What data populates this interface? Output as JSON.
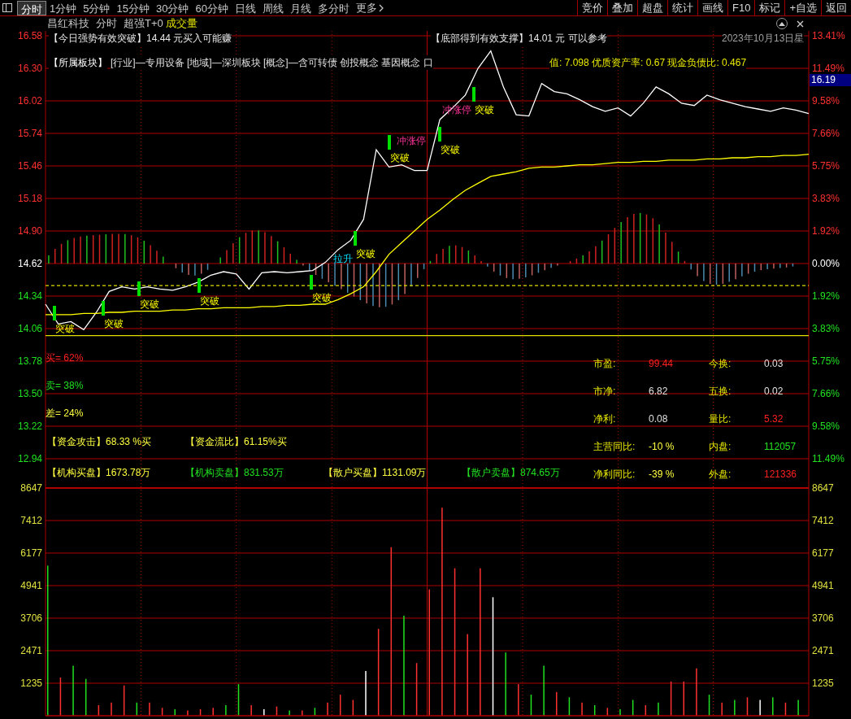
{
  "toolbar": {
    "tabs": [
      {
        "label": "分时",
        "selected": true
      },
      {
        "label": "1分钟",
        "selected": false
      },
      {
        "label": "5分钟",
        "selected": false
      },
      {
        "label": "15分钟",
        "selected": false
      },
      {
        "label": "30分钟",
        "selected": false
      },
      {
        "label": "60分钟",
        "selected": false
      },
      {
        "label": "日线",
        "selected": false
      },
      {
        "label": "周线",
        "selected": false
      },
      {
        "label": "月线",
        "selected": false
      },
      {
        "label": "多分时",
        "selected": false
      }
    ],
    "more": "更多",
    "buttons": [
      "竞价",
      "叠加",
      "超盘",
      "统计",
      "画线",
      "F10",
      "标记",
      "+自选",
      "返回"
    ]
  },
  "title_row": {
    "items": [
      "昌红科技",
      "分时",
      "超强T+0"
    ],
    "indicator": "成交量"
  },
  "info": {
    "signal_left": "【今日强势有效突破】14.44 元买入可能赚",
    "signal_right": "【底部得到有效支撑】14.01 元 可以参考",
    "date": "2023年10月13日星",
    "sector_label": "【所属板块】",
    "sector": "[行业]—专用设备 [地域]—深圳板块 [概念]—含可转债 创投概念 基因概念 口",
    "finance": "值: 7.098 优质资产率: 0.67 现金负债比: 0.467",
    "price_tag": "16.19"
  },
  "price_chart": {
    "chart_data": {
      "type": "line",
      "ylim": [
        12.94,
        16.58
      ],
      "grid": true,
      "yticks": [
        {
          "value": 16.58,
          "label": "16.58"
        },
        {
          "value": 16.3,
          "label": "16.30"
        },
        {
          "value": 16.02,
          "label": "16.02"
        },
        {
          "value": 15.74,
          "label": "15.74"
        },
        {
          "value": 15.46,
          "label": "15.46"
        },
        {
          "value": 15.18,
          "label": "15.18"
        },
        {
          "value": 14.9,
          "label": "14.90"
        },
        {
          "value": 14.62,
          "label": "14.62"
        },
        {
          "value": 14.34,
          "label": "14.34"
        },
        {
          "value": 14.06,
          "label": "14.06"
        },
        {
          "value": 13.78,
          "label": "13.78"
        },
        {
          "value": 13.5,
          "label": "13.50"
        },
        {
          "value": 13.22,
          "label": "13.22"
        },
        {
          "value": 12.94,
          "label": "12.94"
        }
      ],
      "categories": [
        null,
        null,
        null,
        null,
        null,
        null,
        null,
        null,
        null,
        null,
        null,
        null,
        null,
        null,
        null,
        null,
        null,
        null,
        null,
        null,
        null,
        null,
        null,
        null,
        null,
        null,
        null,
        null,
        null,
        null,
        null,
        null,
        null,
        null,
        null,
        null,
        null,
        null,
        null,
        null,
        null,
        null,
        null,
        null,
        null,
        null,
        null,
        null,
        null,
        null,
        null,
        null,
        null,
        null,
        null,
        null,
        null,
        null,
        null,
        null,
        null
      ],
      "series": [
        {
          "color": "#ffffff",
          "values": [
            14.27,
            14.1,
            14.12,
            14.05,
            14.2,
            14.38,
            14.42,
            14.4,
            14.42,
            14.4,
            14.39,
            14.42,
            14.46,
            14.52,
            14.55,
            14.53,
            14.4,
            14.54,
            14.55,
            14.54,
            14.55,
            14.56,
            14.63,
            14.74,
            14.82,
            15.0,
            15.6,
            15.45,
            15.47,
            15.42,
            15.42,
            15.86,
            15.96,
            16.07,
            16.3,
            16.45,
            16.14,
            15.9,
            15.89,
            16.17,
            16.1,
            16.08,
            16.03,
            15.97,
            15.93,
            15.96,
            15.89,
            16.0,
            16.14,
            16.08,
            16.0,
            15.98,
            16.07,
            16.03,
            16.0,
            15.97,
            15.95,
            15.93,
            15.96,
            15.94,
            15.91
          ]
        },
        {
          "color": "#ffff00",
          "values": [
            14.18,
            14.18,
            14.18,
            14.19,
            14.19,
            14.2,
            14.2,
            14.21,
            14.21,
            14.21,
            14.22,
            14.22,
            14.23,
            14.23,
            14.24,
            14.24,
            14.24,
            14.25,
            14.25,
            14.26,
            14.26,
            14.27,
            14.27,
            14.31,
            14.36,
            14.42,
            14.55,
            14.7,
            14.8,
            14.9,
            15.0,
            15.08,
            15.17,
            15.25,
            15.31,
            15.37,
            15.39,
            15.41,
            15.44,
            15.45,
            15.45,
            15.46,
            15.47,
            15.47,
            15.48,
            15.49,
            15.49,
            15.5,
            15.5,
            15.51,
            15.51,
            15.51,
            15.52,
            15.52,
            15.53,
            15.53,
            15.54,
            15.54,
            15.55,
            15.55,
            15.56
          ]
        },
        {
          "color": "#e0e000",
          "line_style": "dashed",
          "values": [
            14.43,
            14.43,
            14.43,
            14.43,
            14.43,
            14.43,
            14.43,
            14.43,
            14.43,
            14.43,
            14.43,
            14.43,
            14.43,
            14.43,
            14.43,
            14.43,
            14.43,
            14.43,
            14.43,
            14.43,
            14.43,
            14.43,
            14.43,
            14.43,
            14.43,
            14.43,
            14.43,
            14.43,
            14.43,
            14.43,
            14.43,
            14.43,
            14.43,
            14.43,
            14.43,
            14.43,
            14.43,
            14.43,
            14.43,
            14.43,
            14.43,
            14.43,
            14.43,
            14.43,
            14.43,
            14.43,
            14.43,
            14.43,
            14.43,
            14.43,
            14.43,
            14.43,
            14.43,
            14.43,
            14.43,
            14.43,
            14.43,
            14.43,
            14.43,
            14.43,
            14.43
          ]
        },
        {
          "color": "#e0e000",
          "values": [
            14.0,
            14.0,
            14.0,
            14.0,
            14.0,
            14.0,
            14.0,
            14.0,
            14.0,
            14.0,
            14.0,
            14.0,
            14.0,
            14.0,
            14.0,
            14.0,
            14.0,
            14.0,
            14.0,
            14.0,
            14.0,
            14.0,
            14.0,
            14.0,
            14.0,
            14.0,
            14.0,
            14.0,
            14.0,
            14.0,
            14.0,
            14.0,
            14.0,
            14.0,
            14.0,
            14.0,
            14.0,
            14.0,
            14.0,
            14.0,
            14.0,
            14.0,
            14.0,
            14.0,
            14.0,
            14.0,
            14.0,
            14.0,
            14.0,
            14.0,
            14.0,
            14.0,
            14.0,
            14.0,
            14.0,
            14.0,
            14.0,
            14.0,
            14.0,
            14.0,
            14.0
          ]
        }
      ]
    },
    "right_axis": [
      "13.41%",
      "11.49%",
      "9.58%",
      "7.66%",
      "5.75%",
      "3.83%",
      "1.92%",
      "0.00%",
      "1.92%",
      "3.83%",
      "5.75%",
      "7.66%",
      "9.58%",
      "11.49%"
    ],
    "signals": [
      {
        "text": "突破",
        "kind": "breakout"
      },
      {
        "text": "突破",
        "kind": "breakout"
      },
      {
        "text": "突破",
        "kind": "breakout"
      },
      {
        "text": "突破",
        "kind": "breakout"
      },
      {
        "text": "突破",
        "kind": "breakout"
      },
      {
        "text": "拉升",
        "kind": "pull_up"
      },
      {
        "text": "突破",
        "kind": "breakout"
      },
      {
        "text": "突破",
        "kind": "breakout"
      },
      {
        "text": "冲涨停",
        "kind": "limit_up"
      },
      {
        "text": "突破",
        "kind": "breakout"
      },
      {
        "text": "冲涨停",
        "kind": "limit_up"
      },
      {
        "text": "突破",
        "kind": "breakout"
      }
    ]
  },
  "ratios": [
    {
      "text": "买= 62%",
      "color": "#ff2020"
    },
    {
      "text": "卖= 38%",
      "color": "#20e020"
    },
    {
      "text": "差= 24%",
      "color": "#ffff40"
    }
  ],
  "funds": [
    [
      {
        "label": "【资金攻击】",
        "value": "68.33 %买",
        "color": "#ffff40"
      },
      {
        "label": "【资金流比】",
        "value": "61.15%买",
        "color": "#ffff40"
      }
    ],
    [
      {
        "label": "【机构买盘】",
        "value": "1673.78万",
        "color": "#ffff40"
      },
      {
        "label": "【机构卖盘】",
        "value": "831.53万",
        "color": "#20e020"
      },
      {
        "label": "【散户买盘】",
        "value": "1131.09万",
        "color": "#ffff40"
      },
      {
        "label": "【散户卖盘】",
        "value": "874.65万",
        "color": "#20e020"
      }
    ]
  ],
  "stats": [
    [
      {
        "label": "市盈:",
        "value": "99.44",
        "color": "#ff2020"
      },
      {
        "label": "今换:",
        "value": "0.03",
        "color": "#e0e0e0"
      }
    ],
    [
      {
        "label": "市净:",
        "value": "6.82",
        "color": "#e0e0e0"
      },
      {
        "label": "五换:",
        "value": "0.02",
        "color": "#e0e0e0"
      }
    ],
    [
      {
        "label": "净利:",
        "value": "0.08",
        "color": "#e0e0e0"
      },
      {
        "label": "量比:",
        "value": "5.32",
        "color": "#ff2020"
      }
    ],
    [
      {
        "label": "主营同比:",
        "value": "-10 %",
        "color": "#ffff40"
      },
      {
        "label": "内盘:",
        "value": "112057",
        "color": "#20e020"
      }
    ],
    [
      {
        "label": "净利同比:",
        "value": "-39 %",
        "color": "#ffff40"
      },
      {
        "label": "外盘:",
        "value": "121336",
        "color": "#ff2020"
      }
    ]
  ],
  "volume_chart": {
    "chart_data": {
      "type": "bar",
      "ylim": [
        0,
        8647
      ],
      "grid": true,
      "yticks": [
        {
          "value": 8647,
          "label": "8647"
        },
        {
          "value": 7412,
          "label": "7412"
        },
        {
          "value": 6177,
          "label": "6177"
        },
        {
          "value": 4941,
          "label": "4941"
        },
        {
          "value": 3706,
          "label": "3706"
        },
        {
          "value": 2471,
          "label": "2471"
        },
        {
          "value": 1235,
          "label": "1235"
        }
      ],
      "categories": [
        null,
        null,
        null,
        null,
        null,
        null,
        null,
        null,
        null,
        null,
        null,
        null,
        null,
        null,
        null,
        null,
        null,
        null,
        null,
        null,
        null,
        null,
        null,
        null,
        null,
        null,
        null,
        null,
        null,
        null,
        null,
        null,
        null,
        null,
        null,
        null,
        null,
        null,
        null,
        null,
        null,
        null,
        null,
        null,
        null,
        null,
        null,
        null,
        null,
        null,
        null,
        null,
        null,
        null,
        null,
        null,
        null,
        null,
        null,
        null
      ],
      "series": [
        {
          "color": "#ff3030",
          "values": [
            null,
            1450,
            null,
            null,
            400,
            500,
            1150,
            null,
            500,
            300,
            null,
            200,
            250,
            300,
            null,
            null,
            400,
            null,
            350,
            null,
            200,
            null,
            500,
            800,
            600,
            null,
            3300,
            6400,
            null,
            2000,
            4800,
            7900,
            5600,
            3100,
            5600,
            null,
            null,
            1200,
            null,
            null,
            900,
            null,
            500,
            null,
            300,
            null,
            null,
            400,
            null,
            1300,
            1300,
            1800,
            null,
            500,
            null,
            700,
            null,
            null,
            500,
            null
          ]
        },
        {
          "color": "#20e020",
          "values": [
            5700,
            null,
            1900,
            1400,
            null,
            null,
            null,
            500,
            null,
            null,
            250,
            null,
            null,
            null,
            400,
            1200,
            null,
            null,
            null,
            200,
            null,
            300,
            null,
            null,
            null,
            null,
            null,
            null,
            3800,
            null,
            null,
            null,
            null,
            null,
            null,
            null,
            2400,
            null,
            800,
            1900,
            null,
            700,
            null,
            400,
            null,
            250,
            600,
            null,
            500,
            null,
            null,
            null,
            800,
            null,
            600,
            null,
            null,
            700,
            null,
            600
          ]
        },
        {
          "color": "#ffffff",
          "values": [
            null,
            null,
            null,
            null,
            null,
            null,
            null,
            null,
            null,
            null,
            null,
            null,
            null,
            null,
            null,
            null,
            null,
            250,
            null,
            null,
            null,
            null,
            null,
            null,
            null,
            1700,
            null,
            null,
            null,
            null,
            null,
            null,
            null,
            null,
            null,
            4500,
            null,
            null,
            null,
            null,
            null,
            null,
            null,
            null,
            null,
            null,
            null,
            null,
            null,
            null,
            null,
            null,
            null,
            null,
            null,
            null,
            600,
            null,
            null,
            null
          ]
        }
      ]
    },
    "right_axis": [
      "8647",
      "7412",
      "6177",
      "4941",
      "3706",
      "2471",
      "1235"
    ]
  }
}
